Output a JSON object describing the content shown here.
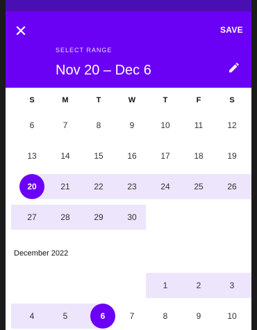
{
  "header": {
    "save_label": "SAVE",
    "select_label": "SELECT RANGE",
    "range_title": "Nov 20 – Dec 6",
    "accent_color": "#6a00f4",
    "range_band_color": "#ece5fb"
  },
  "icons": {
    "close": "close-icon",
    "edit": "pencil-icon"
  },
  "weekdays": [
    "S",
    "M",
    "T",
    "W",
    "T",
    "F",
    "S"
  ],
  "november": {
    "weeks": [
      [
        "6",
        "7",
        "8",
        "9",
        "10",
        "11",
        "12"
      ],
      [
        "13",
        "14",
        "15",
        "16",
        "17",
        "18",
        "19"
      ],
      [
        "20",
        "21",
        "22",
        "23",
        "24",
        "25",
        "26"
      ],
      [
        "27",
        "28",
        "29",
        "30"
      ]
    ]
  },
  "december": {
    "title": "December 2022",
    "weeks": [
      [
        "1",
        "2",
        "3"
      ],
      [
        "4",
        "5",
        "6",
        "7",
        "8",
        "9",
        "10"
      ]
    ]
  }
}
